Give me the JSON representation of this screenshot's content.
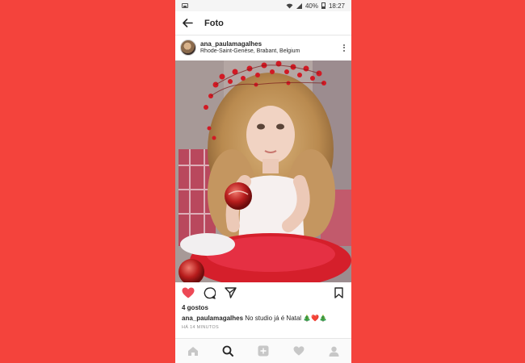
{
  "status_bar": {
    "battery": "40%",
    "time": "18:27",
    "icons": [
      "image-notification-icon",
      "wifi-icon",
      "signal-icon",
      "battery-icon"
    ]
  },
  "top_bar": {
    "title": "Foto",
    "back_icon": "back-arrow-icon"
  },
  "post": {
    "username": "ana_paulamagalhes",
    "location": "Rhode-Saint-Genèse, Brabant, Belgium",
    "likes": "4 gostos",
    "caption_user": "ana_paulamagalhes",
    "caption_text": " No studio já é Natal 🎄❤️🎄",
    "timestamp": "HÁ 14 MINUTOS",
    "liked": true
  },
  "actions": [
    "heart-icon",
    "comment-icon",
    "share-icon",
    "save-icon"
  ],
  "tab_bar": [
    "home-icon",
    "search-icon",
    "add-post-icon",
    "activity-heart-icon",
    "profile-icon"
  ],
  "colors": {
    "background": "#f4433c",
    "like_red": "#ed4956",
    "text": "#262626",
    "muted": "#8e8e8e"
  }
}
